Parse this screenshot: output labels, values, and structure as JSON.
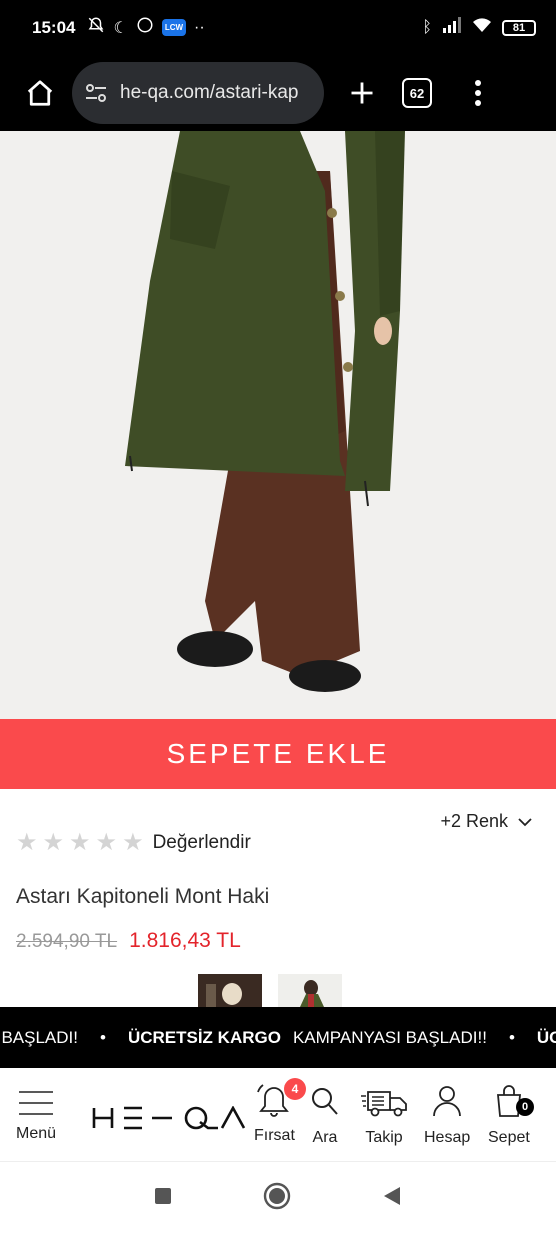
{
  "status": {
    "time": "15:04",
    "battery": "81"
  },
  "browser": {
    "url": "he-qa.com/astari-kap",
    "tab_count": "62"
  },
  "product": {
    "add_to_cart": "SEPETE EKLE",
    "rating_label": "Değerlendir",
    "rating_value": 0,
    "rating_max": 5,
    "more_colors": "+2 Renk",
    "title": "Astarı Kapitoneli Mont Haki",
    "old_price": "2.594,90 TL",
    "new_price": "1.816,43 TL"
  },
  "marquee": {
    "left_fragment": "I BAŞLADI!",
    "bold_text": "ÜCRETSİZ KARGO",
    "normal_text": "KAMPANYASI BAŞLADI!!",
    "right_fragment": "ÜCRE",
    "separator": "•"
  },
  "nav": {
    "menu": "Menü",
    "logo": "HE-QA",
    "firsat": "Fırsat",
    "firsat_badge": "4",
    "ara": "Ara",
    "takip": "Takip",
    "hesap": "Hesap",
    "sepet": "Sepet",
    "sepet_badge": "0"
  },
  "colors": {
    "accent": "#fa4a4c",
    "price_red": "#e3242b",
    "coat_green": "#3f4d26",
    "trouser_brown": "#5a3122"
  },
  "icons": [
    "home-icon",
    "tune-icon",
    "plus-icon",
    "tab-switcher-icon",
    "more-vert-icon",
    "star-icon",
    "chevron-down-icon",
    "hamburger-icon",
    "bell-icon",
    "search-icon",
    "truck-icon",
    "user-icon",
    "bag-icon"
  ]
}
